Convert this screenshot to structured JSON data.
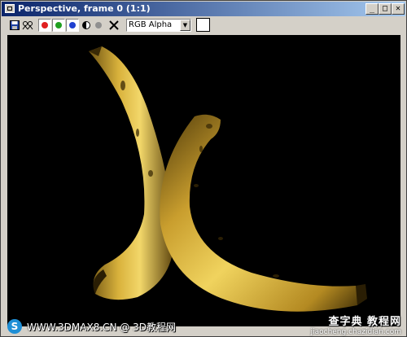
{
  "window": {
    "title": "Perspective, frame 0 (1:1)",
    "controls": {
      "minimize": "_",
      "maximize": "□",
      "close": "✕"
    }
  },
  "toolbar": {
    "tools": [
      {
        "name": "save-icon"
      },
      {
        "name": "clone-icon"
      },
      {
        "name": "red-channel-icon",
        "color": "#e02020"
      },
      {
        "name": "green-channel-icon",
        "color": "#20a020"
      },
      {
        "name": "blue-channel-icon",
        "color": "#2040d0"
      },
      {
        "name": "mono-icon"
      },
      {
        "name": "alpha-channel-icon",
        "color": "#909090"
      },
      {
        "name": "clear-icon"
      }
    ],
    "channel_select": {
      "value": "RGB Alpha"
    },
    "background_swatch": {
      "color": "#ffffff"
    }
  },
  "watermark": {
    "left": "WWW.3DMAX8.CN @ 3D教程网",
    "right_title": "查字典 教程网",
    "right_url": "jiaocheng.chazidian.com"
  }
}
